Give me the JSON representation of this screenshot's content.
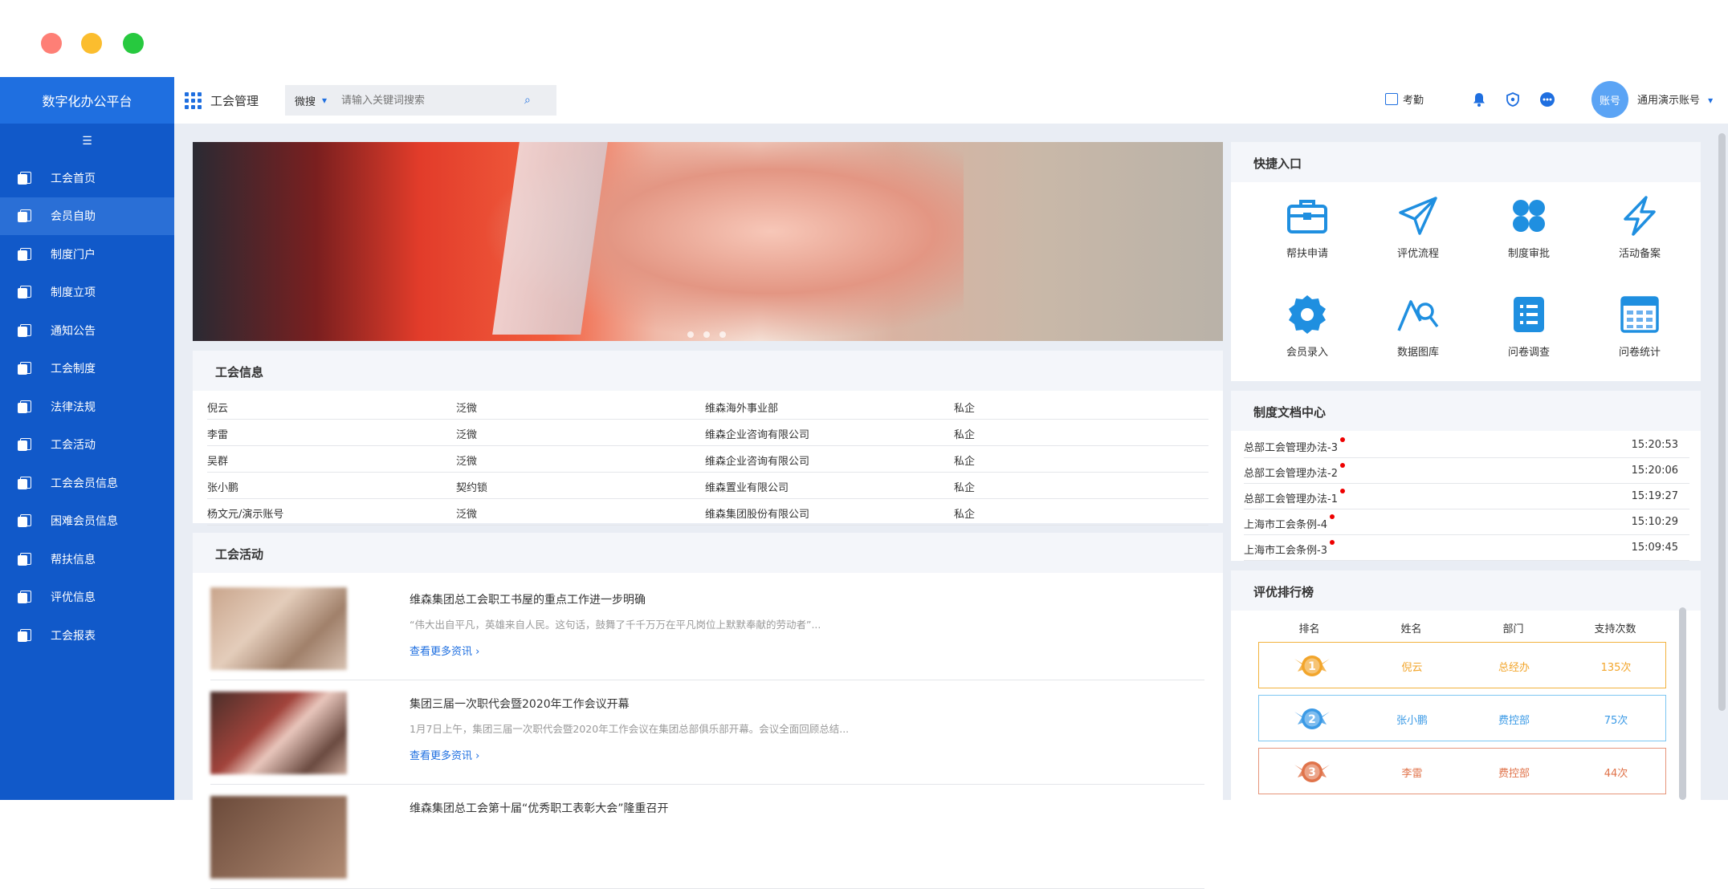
{
  "window": {
    "controls": [
      "close",
      "minimize",
      "maximize"
    ]
  },
  "sidebar": {
    "brand": "数字化办公平台",
    "collapse_icon": "menu-fold-icon",
    "items": [
      {
        "label": "工会首页"
      },
      {
        "label": "会员自助",
        "active": true
      },
      {
        "label": "制度门户"
      },
      {
        "label": "制度立项"
      },
      {
        "label": "通知公告"
      },
      {
        "label": "工会制度"
      },
      {
        "label": "法律法规"
      },
      {
        "label": "工会活动"
      },
      {
        "label": "工会会员信息"
      },
      {
        "label": "困难会员信息"
      },
      {
        "label": "帮扶信息"
      },
      {
        "label": "评优信息"
      },
      {
        "label": "工会报表"
      }
    ]
  },
  "topbar": {
    "module_title": "工会管理",
    "search_scope": "微搜",
    "search_placeholder": "请输入关键词搜索",
    "attendance": "考勤",
    "avatar_text": "账号",
    "account_name": "通用演示账号"
  },
  "info": {
    "title": "工会信息",
    "rows": [
      [
        "倪云",
        "泛微",
        "维森海外事业部",
        "私企"
      ],
      [
        "李雷",
        "泛微",
        "维森企业咨询有限公司",
        "私企"
      ],
      [
        "吴群",
        "泛微",
        "维森企业咨询有限公司",
        "私企"
      ],
      [
        "张小鹏",
        "契约锁",
        "维森置业有限公司",
        "私企"
      ],
      [
        "杨文元/演示账号",
        "泛微",
        "维森集团股份有限公司",
        "私企"
      ]
    ]
  },
  "activity": {
    "title": "工会活动",
    "more": "查看更多资讯",
    "items": [
      {
        "title": "维森集团总工会职工书屋的重点工作进一步明确",
        "desc": "“伟大出自平凡，英雄来自人民。这句话，鼓舞了千千万万在平凡岗位上默默奉献的劳动者”..."
      },
      {
        "title": "集团三届一次职代会暨2020年工作会议开幕",
        "desc": "1月7日上午，集团三届一次职代会暨2020年工作会议在集团总部俱乐部开幕。会议全面回顾总结..."
      },
      {
        "title": "维森集团总工会第十届“优秀职工表彰大会”隆重召开",
        "desc": ""
      }
    ]
  },
  "quick": {
    "title": "快捷入口",
    "items": [
      {
        "label": "帮扶申请",
        "icon": "briefcase-icon"
      },
      {
        "label": "评优流程",
        "icon": "paper-plane-icon"
      },
      {
        "label": "制度审批",
        "icon": "clover-icon"
      },
      {
        "label": "活动备案",
        "icon": "lightning-icon"
      },
      {
        "label": "会员录入",
        "icon": "gear-icon"
      },
      {
        "label": "数据图库",
        "icon": "chart-search-icon"
      },
      {
        "label": "问卷调查",
        "icon": "list-icon"
      },
      {
        "label": "问卷统计",
        "icon": "table-icon"
      }
    ]
  },
  "docs": {
    "title": "制度文档中心",
    "rows": [
      {
        "name": "总部工会管理办法-3",
        "time": "15:20:53"
      },
      {
        "name": "总部工会管理办法-2",
        "time": "15:20:06"
      },
      {
        "name": "总部工会管理办法-1",
        "time": "15:19:27"
      },
      {
        "name": "上海市工会条例-4",
        "time": "15:10:29"
      },
      {
        "name": "上海市工会条例-3",
        "time": "15:09:45"
      }
    ]
  },
  "rank": {
    "title": "评优排行榜",
    "columns": [
      "排名",
      "姓名",
      "部门",
      "支持次数"
    ],
    "rows": [
      {
        "rank": "1",
        "name": "倪云",
        "dept": "总经办",
        "count": "135次",
        "color": "#f2a52b",
        "border": "#f2b23d"
      },
      {
        "rank": "2",
        "name": "张小鹏",
        "dept": "费控部",
        "count": "75次",
        "color": "#3b9ae6",
        "border": "#7cc6f2"
      },
      {
        "rank": "3",
        "name": "李雷",
        "dept": "费控部",
        "count": "44次",
        "color": "#e0734a",
        "border": "#e6957a"
      }
    ]
  },
  "colors": {
    "primary": "#1f6fe0",
    "sidebar": "#1159c9",
    "badge": "#e00000"
  }
}
